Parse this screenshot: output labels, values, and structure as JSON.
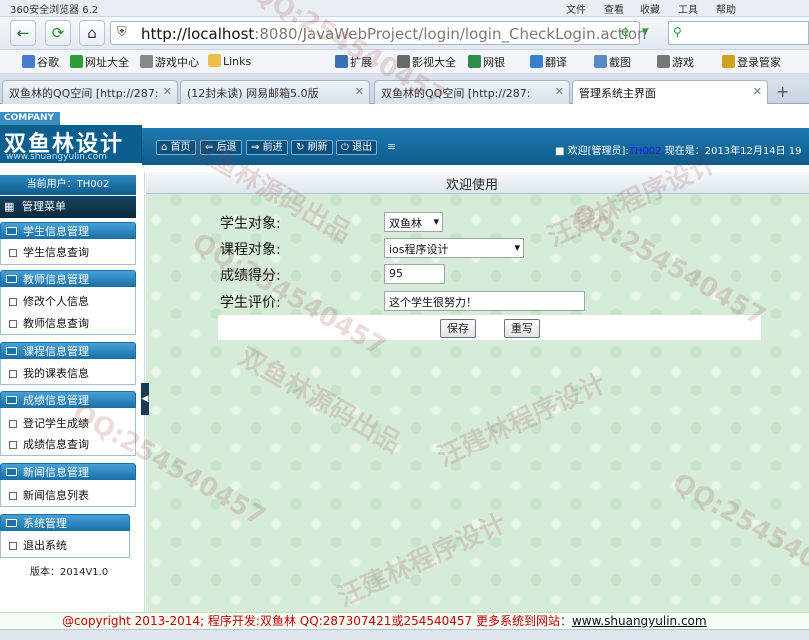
{
  "browser": {
    "title": "360安全浏览器 6.2",
    "menu": [
      "文件",
      "查看",
      "收藏",
      "工具",
      "帮助"
    ],
    "url_host": "http://localhost",
    "url_rest": ":8080/JavaWebProject/login/login_CheckLogin.action",
    "bookmarks": [
      "谷歌",
      "网址大全",
      "游戏中心",
      "Links",
      "扩展",
      "影视大全",
      "网银",
      "翻译",
      "截图",
      "游戏",
      "登录管家"
    ],
    "tabs": [
      {
        "label": "双鱼林的QQ空间 [http://287:",
        "active": false
      },
      {
        "label": "(12封未读) 网易邮箱5.0版",
        "active": false
      },
      {
        "label": "双鱼林的QQ空间 [http://287:",
        "active": false
      },
      {
        "label": "管理系统主界面",
        "active": true
      }
    ],
    "new_tab": "+"
  },
  "header": {
    "company": "COMPANY",
    "logo_text": "双鱼林设计",
    "logo_url": "www.shuangyulin.com",
    "nav": [
      "首页",
      "后退",
      "前进",
      "刷新",
      "退出"
    ],
    "welcome_prefix": "欢迎[管理员]:",
    "welcome_user": "TH002",
    "welcome_suffix": "现在是：2013年12月14日  19"
  },
  "sidebar": {
    "current_user": "当前用户：TH002",
    "menu_title": "管理菜单",
    "sections": [
      {
        "title": "学生信息管理",
        "items": [
          "学生信息查询"
        ]
      },
      {
        "title": "教师信息管理",
        "items": [
          "修改个人信息",
          "教师信息查询"
        ]
      },
      {
        "title": "课程信息管理",
        "items": [
          "我的课表信息"
        ]
      },
      {
        "title": "成绩信息管理",
        "items": [
          "登记学生成绩",
          "成绩信息查询"
        ]
      },
      {
        "title": "新闻信息管理",
        "items": [
          "新闻信息列表"
        ]
      },
      {
        "title": "系统管理",
        "items": [
          "退出系统"
        ]
      }
    ],
    "version": "版本：2014V1.0"
  },
  "main": {
    "title": "欢迎使用",
    "form": {
      "student_label": "学生对象:",
      "student_value": "双鱼林",
      "course_label": "课程对象:",
      "course_value": "ios程序设计",
      "score_label": "成绩得分:",
      "score_value": "95",
      "comment_label": "学生评价:",
      "comment_value": "这个学生很努力！",
      "save_label": "保存",
      "reset_label": "重写"
    }
  },
  "footer": {
    "text": "@copyright 2013-2014; 程序开发:双鱼林  QQ:287307421或254540457  更多系统到网站：",
    "url": "www.shuangyulin.com"
  },
  "watermarks": [
    "QQ:254540457",
    "汪建林程序设计",
    "双鱼林源码出品"
  ]
}
